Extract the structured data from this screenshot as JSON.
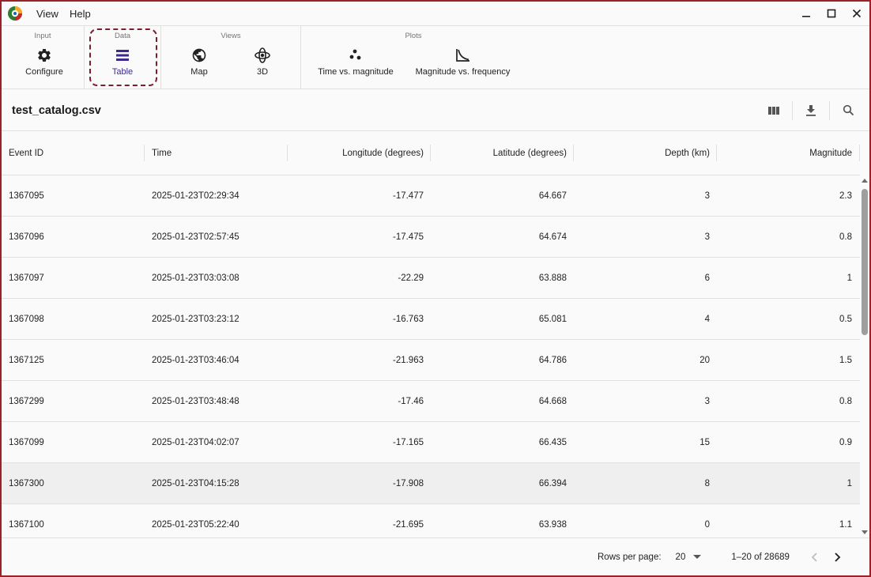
{
  "menu": [
    "View",
    "Help"
  ],
  "ribbon": {
    "groups": [
      {
        "label": "Input"
      },
      {
        "label": "Data"
      },
      {
        "label": "Views"
      },
      {
        "label": "Plots"
      }
    ],
    "buttons": {
      "configure": "Configure",
      "table": "Table",
      "map": "Map",
      "three_d": "3D",
      "time_vs_magnitude": "Time vs. magnitude",
      "magnitude_vs_frequency": "Magnitude vs. frequency"
    }
  },
  "toolbar": {
    "file_name": "test_catalog.csv"
  },
  "table": {
    "columns": [
      "Event ID",
      "Time",
      "Longitude (degrees)",
      "Latitude (degrees)",
      "Depth (km)",
      "Magnitude"
    ],
    "rows": [
      [
        "1367095",
        "2025-01-23T02:29:34",
        "-17.477",
        "64.667",
        "3",
        "2.3"
      ],
      [
        "1367096",
        "2025-01-23T02:57:45",
        "-17.475",
        "64.674",
        "3",
        "0.8"
      ],
      [
        "1367097",
        "2025-01-23T03:03:08",
        "-22.29",
        "63.888",
        "6",
        "1"
      ],
      [
        "1367098",
        "2025-01-23T03:23:12",
        "-16.763",
        "65.081",
        "4",
        "0.5"
      ],
      [
        "1367125",
        "2025-01-23T03:46:04",
        "-21.963",
        "64.786",
        "20",
        "1.5"
      ],
      [
        "1367299",
        "2025-01-23T03:48:48",
        "-17.46",
        "64.668",
        "3",
        "0.8"
      ],
      [
        "1367099",
        "2025-01-23T04:02:07",
        "-17.165",
        "66.435",
        "15",
        "0.9"
      ],
      [
        "1367300",
        "2025-01-23T04:15:28",
        "-17.908",
        "66.394",
        "8",
        "1"
      ],
      [
        "1367100",
        "2025-01-23T05:22:40",
        "-21.695",
        "63.938",
        "0",
        "1.1"
      ]
    ]
  },
  "pagination": {
    "rows_per_page_label": "Rows per page:",
    "rows_per_page": "20",
    "range": "1–20 of 28689"
  },
  "colors": {
    "accent": "#3f2a8c",
    "frame": "#9b2226",
    "focus_ring": "#7a1f2b"
  }
}
